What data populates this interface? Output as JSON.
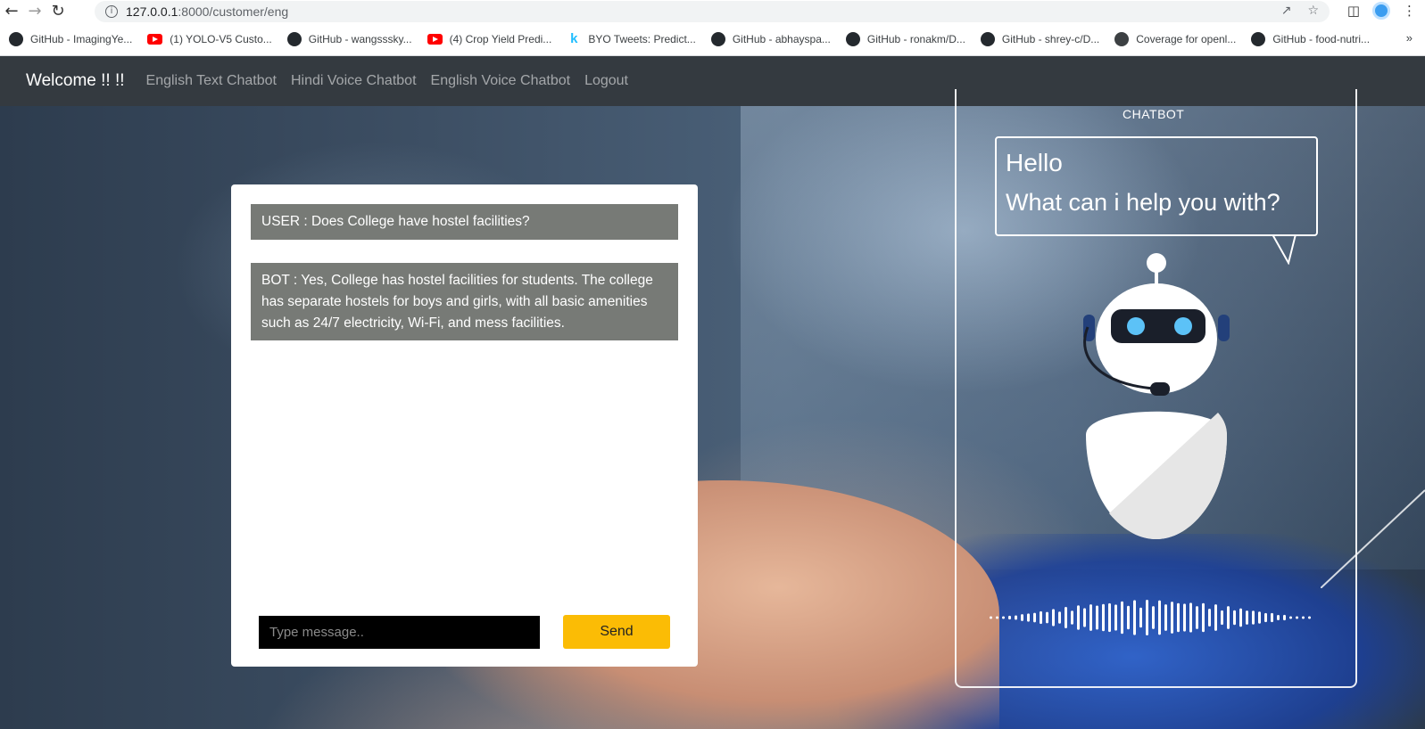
{
  "browser": {
    "url_host": "127.0.0.1",
    "url_path": ":8000/customer/eng",
    "bookmarks": [
      {
        "label": "GitHub - ImagingYe...",
        "icon": "github-icon"
      },
      {
        "label": "(1) YOLO-V5 Custo...",
        "icon": "youtube-icon"
      },
      {
        "label": "GitHub - wangsssky...",
        "icon": "github-icon"
      },
      {
        "label": "(4) Crop Yield Predi...",
        "icon": "youtube-icon"
      },
      {
        "label": "BYO Tweets: Predict...",
        "icon": "kaggle-icon"
      },
      {
        "label": "GitHub - abhayspa...",
        "icon": "github-icon"
      },
      {
        "label": "GitHub - ronakm/D...",
        "icon": "github-icon"
      },
      {
        "label": "GitHub - shrey-c/D...",
        "icon": "github-icon"
      },
      {
        "label": "Coverage for openl...",
        "icon": "globe-icon"
      },
      {
        "label": "GitHub - food-nutri...",
        "icon": "github-icon"
      }
    ],
    "more": "»"
  },
  "navbar": {
    "brand": "Welcome !! !!",
    "links": [
      "English Text Chatbot",
      "Hindi Voice Chatbot",
      "English Voice Chatbot",
      "Logout"
    ]
  },
  "chat": {
    "messages": [
      {
        "role": "user",
        "text": "USER : Does College have hostel facilities?"
      },
      {
        "role": "bot",
        "text": "BOT : Yes, College has hostel facilities for students. The college has separate hostels for boys and girls, with all basic amenities such as 24/7 electricity, Wi-Fi, and mess facilities."
      }
    ],
    "input_placeholder": "Type message..",
    "send_label": "Send"
  },
  "illustration": {
    "title": "CHATBOT",
    "bubble_line1": "Hello",
    "bubble_line2": "What can i help you with?"
  }
}
